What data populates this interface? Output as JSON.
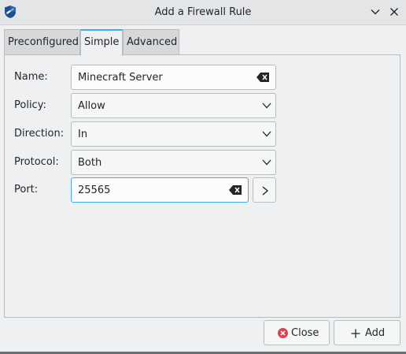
{
  "window": {
    "title": "Add a Firewall Rule",
    "minimize_icon": "chevron-down-icon",
    "close_icon": "close-icon"
  },
  "tabs": [
    {
      "label": "Preconfigured",
      "active": false
    },
    {
      "label": "Simple",
      "active": true
    },
    {
      "label": "Advanced",
      "active": false
    }
  ],
  "form": {
    "name": {
      "label": "Name:",
      "value": "Minecraft Server"
    },
    "policy": {
      "label": "Policy:",
      "value": "Allow"
    },
    "direction": {
      "label": "Direction:",
      "value": "In"
    },
    "protocol": {
      "label": "Protocol:",
      "value": "Both"
    },
    "port": {
      "label": "Port:",
      "value": "25565"
    }
  },
  "buttons": {
    "close_label": "Close",
    "add_label": "Add"
  },
  "colors": {
    "accent": "#3daee9",
    "close_icon_red": "#da4453"
  }
}
